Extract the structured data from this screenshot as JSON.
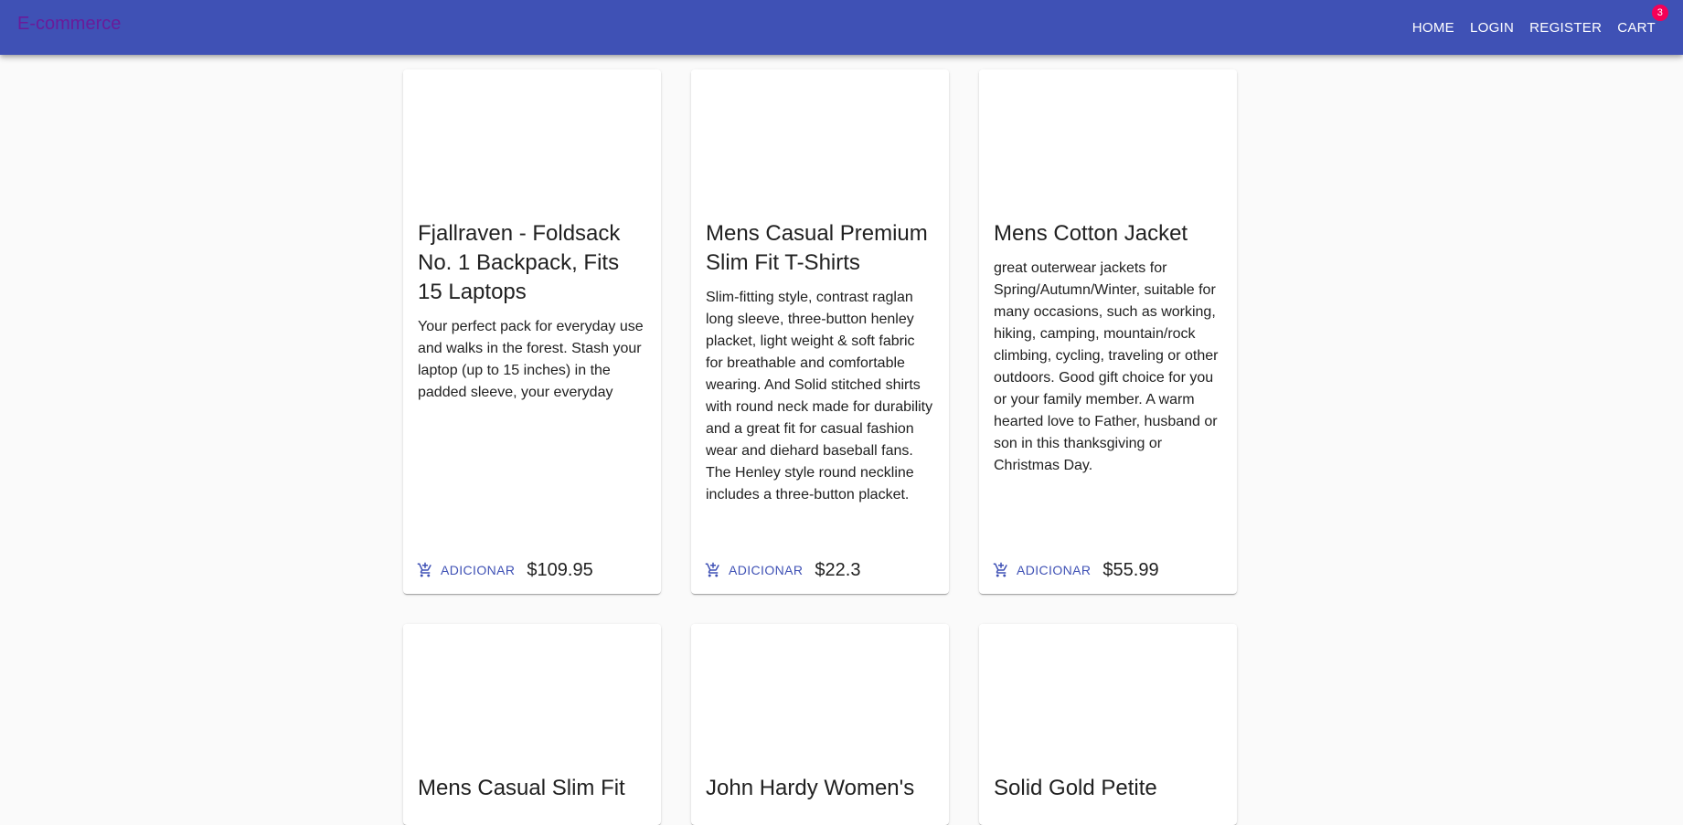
{
  "appbar": {
    "brand": "E-commerce",
    "nav": [
      {
        "label": "HOME"
      },
      {
        "label": "LOGIN"
      },
      {
        "label": "REGISTER"
      },
      {
        "label": "CART"
      }
    ],
    "cart_count": "3"
  },
  "products": [
    {
      "title": "Fjallraven - Foldsack No. 1 Backpack, Fits 15 Laptops",
      "description": "Your perfect pack for everyday use and walks in the forest. Stash your laptop (up to 15 inches) in the padded sleeve, your everyday",
      "add_label": "ADICIONAR",
      "price": "$109.95"
    },
    {
      "title": "Mens Casual Premium Slim Fit T-Shirts",
      "description": "Slim-fitting style, contrast raglan long sleeve, three-button henley placket, light weight & soft fabric for breathable and comfortable wearing. And Solid stitched shirts with round neck made for durability and a great fit for casual fashion wear and diehard baseball fans. The Henley style round neckline includes a three-button placket.",
      "add_label": "ADICIONAR",
      "price": "$22.3"
    },
    {
      "title": "Mens Cotton Jacket",
      "description": "great outerwear jackets for Spring/Autumn/Winter, suitable for many occasions, such as working, hiking, camping, mountain/rock climbing, cycling, traveling or other outdoors. Good gift choice for you or your family member. A warm hearted love to Father, husband or son in this thanksgiving or Christmas Day.",
      "add_label": "ADICIONAR",
      "price": "$55.99"
    },
    {
      "title": "Mens Casual Slim Fit",
      "description": "",
      "add_label": "",
      "price": ""
    },
    {
      "title": "John Hardy Women's",
      "description": "",
      "add_label": "",
      "price": ""
    },
    {
      "title": "Solid Gold Petite",
      "description": "",
      "add_label": "",
      "price": ""
    }
  ]
}
